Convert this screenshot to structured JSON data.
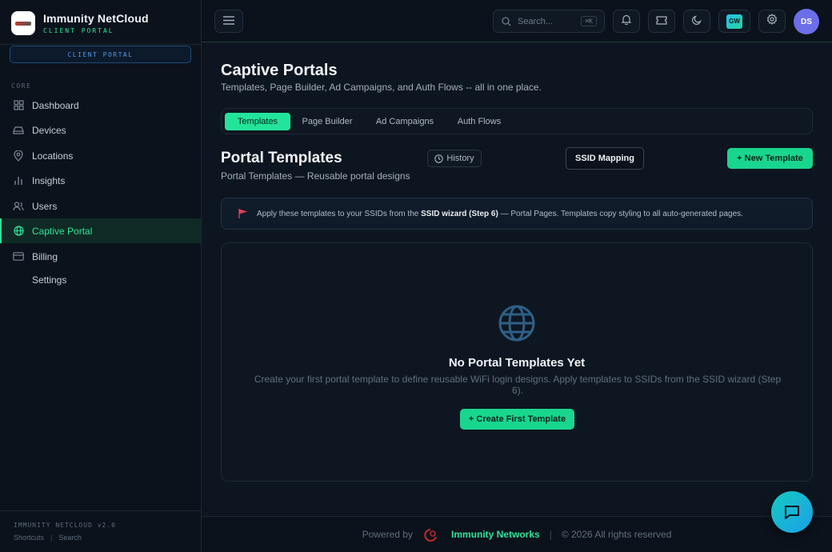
{
  "brand": {
    "title": "Immunity NetCloud",
    "subtitle": "CLIENT PORTAL",
    "pill": "CLIENT PORTAL"
  },
  "sidebar": {
    "section": "CORE",
    "items": [
      {
        "label": "Dashboard",
        "icon": "grid-icon"
      },
      {
        "label": "Devices",
        "icon": "hard-drive-icon"
      },
      {
        "label": "Locations",
        "icon": "map-pin-icon"
      },
      {
        "label": "Insights",
        "icon": "bar-chart-icon"
      },
      {
        "label": "Users",
        "icon": "users-icon"
      },
      {
        "label": "Captive Portal",
        "icon": "globe-icon",
        "active": true
      },
      {
        "label": "Billing",
        "icon": "credit-card-icon"
      },
      {
        "label": "Settings",
        "icon": ""
      }
    ],
    "version": "IMMUNITY NETCLOUD v2.0",
    "links": [
      "Shortcuts",
      "|",
      "Search"
    ]
  },
  "topbar": {
    "search_placeholder": "Search...",
    "search_shortcut": "⌘K",
    "gw_badge": "GW",
    "avatar_initials": "DS"
  },
  "page": {
    "title": "Captive Portals",
    "subtitle": "Templates, Page Builder, Ad Campaigns, and Auth Flows -- all in one place."
  },
  "tabs": [
    {
      "label": "Templates",
      "active": true
    },
    {
      "label": "Page Builder"
    },
    {
      "label": "Ad Campaigns"
    },
    {
      "label": "Auth Flows"
    }
  ],
  "section": {
    "title": "Portal Templates",
    "subtitle": "Portal Templates — Reusable portal designs",
    "history_label": "History",
    "ssid_mapping_label": "SSID Mapping",
    "new_template_label": "+ New Template"
  },
  "banner": {
    "prefix": "Apply these templates to your SSIDs from the",
    "bold": "SSID wizard (Step 6)",
    "suffix": "— Portal Pages. Templates copy styling to all auto-generated pages."
  },
  "empty": {
    "title": "No Portal Templates Yet",
    "description": "Create your first portal template to define reusable WiFi login designs. Apply templates to SSIDs from the SSID wizard (Step 6).",
    "button": "+ Create First Template"
  },
  "footer": {
    "powered_by": "Powered by",
    "brand": "Immunity Networks",
    "separator": "|",
    "copyright": "© 2026 All rights reserved"
  },
  "colors": {
    "accent": "#22e59b",
    "background": "#0d1520",
    "sidebar": "#0b121b",
    "link_blue": "#4f9be8"
  }
}
